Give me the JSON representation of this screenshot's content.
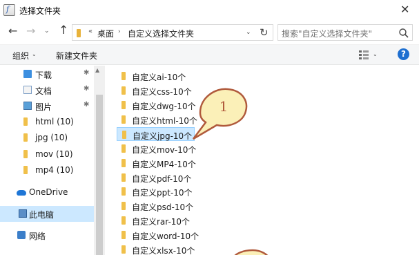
{
  "window": {
    "title": "选择文件夹",
    "app_icon_glyph": "f",
    "close_glyph": "✕"
  },
  "address": {
    "back_glyph": "←",
    "forward_glyph": "→",
    "dropdown_glyph": "⌄",
    "up_glyph": "↑",
    "overflow_glyph": "«",
    "path": [
      "桌面",
      "自定义选择文件夹"
    ],
    "separator_glyph": "›",
    "refresh_glyph": "↻"
  },
  "search": {
    "placeholder": "搜索\"自定义选择文件夹\""
  },
  "toolbar": {
    "organize_label": "组织",
    "new_folder_label": "新建文件夹",
    "help_glyph": "?"
  },
  "sidebar": {
    "items": [
      {
        "label": "下载",
        "icon": "download-icon",
        "pinned": true
      },
      {
        "label": "文档",
        "icon": "document-icon",
        "pinned": true
      },
      {
        "label": "图片",
        "icon": "picture-icon",
        "pinned": true
      },
      {
        "label": "html (10)",
        "icon": "folder-icon",
        "pinned": false
      },
      {
        "label": "jpg (10)",
        "icon": "folder-icon",
        "pinned": false
      },
      {
        "label": "mov (10)",
        "icon": "folder-icon",
        "pinned": false
      },
      {
        "label": "mp4 (10)",
        "icon": "folder-icon",
        "pinned": false
      },
      {
        "label": "OneDrive",
        "icon": "onedrive-icon",
        "pinned": false
      },
      {
        "label": "此电脑",
        "icon": "this-pc-icon",
        "pinned": false,
        "selected": true
      },
      {
        "label": "网络",
        "icon": "network-icon",
        "pinned": false
      }
    ],
    "pin_glyph": "✱"
  },
  "files": [
    {
      "name": "自定义ai-10个"
    },
    {
      "name": "自定义css-10个"
    },
    {
      "name": "自定义dwg-10个"
    },
    {
      "name": "自定义html-10个"
    },
    {
      "name": "自定义jpg-10个",
      "selected": true
    },
    {
      "name": "自定义mov-10个"
    },
    {
      "name": "自定义MP4-10个"
    },
    {
      "name": "自定义pdf-10个"
    },
    {
      "name": "自定义ppt-10个"
    },
    {
      "name": "自定义psd-10个"
    },
    {
      "name": "自定义rar-10个"
    },
    {
      "name": "自定义word-10个"
    },
    {
      "name": "自定义xlsx-10个"
    }
  ],
  "annotation": {
    "callout_number": "1"
  },
  "colors": {
    "selection": "#cce8ff",
    "folder": "#f0c04a",
    "callout_fill": "#fbf0b8",
    "callout_stroke": "#b05a3c",
    "help": "#1e6fd0"
  }
}
